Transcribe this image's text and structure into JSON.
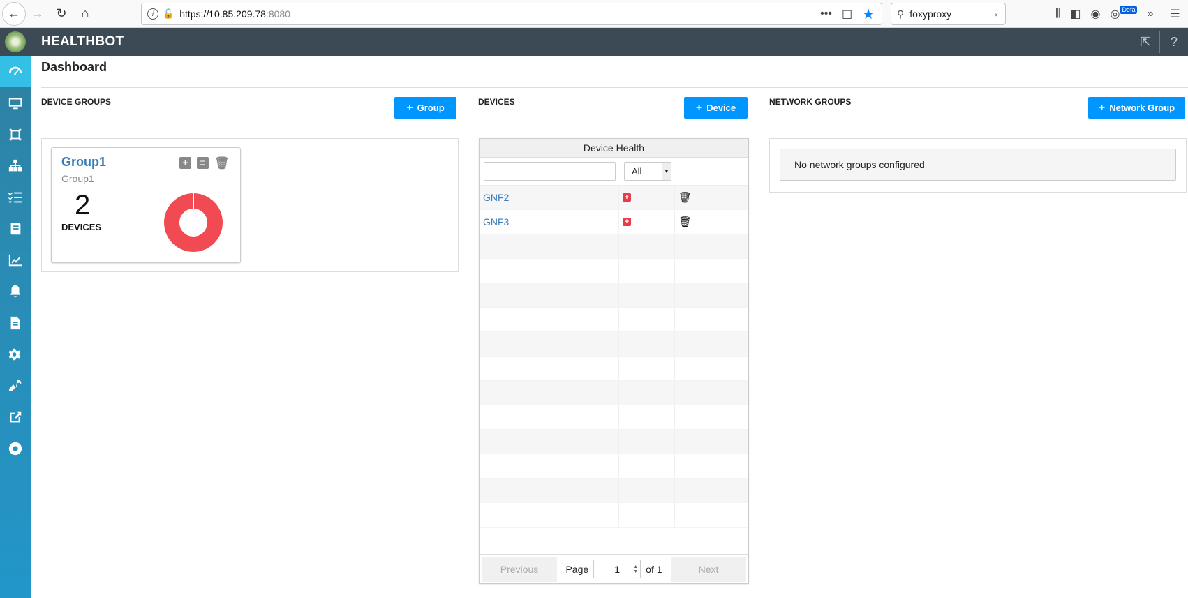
{
  "browser": {
    "url_host": "https://10.85.209.78",
    "url_port": ":8080",
    "search_text": "foxyproxy",
    "badge": "Defa"
  },
  "app": {
    "title": "HEALTHBOT",
    "help": "?"
  },
  "sidebar": {
    "items": [
      {
        "icon": "dashboard-icon",
        "active": true
      },
      {
        "icon": "monitor-icon"
      },
      {
        "icon": "crop-icon"
      },
      {
        "icon": "network-icon"
      },
      {
        "icon": "list-icon"
      },
      {
        "icon": "book-icon"
      },
      {
        "icon": "chart-icon"
      },
      {
        "icon": "bell-icon"
      },
      {
        "icon": "document-icon"
      },
      {
        "icon": "settings-icon"
      },
      {
        "icon": "wrench-icon"
      },
      {
        "icon": "external-link-icon"
      },
      {
        "icon": "lifebuoy-icon"
      }
    ]
  },
  "dashboard": {
    "title": "Dashboard",
    "device_groups": {
      "label": "DEVICE GROUPS",
      "add_label": "Group",
      "cards": [
        {
          "name": "Group1",
          "subtitle": "Group1",
          "count": "2",
          "count_label": "DEVICES",
          "health": {
            "red": 1.0
          }
        }
      ]
    },
    "devices": {
      "label": "DEVICES",
      "add_label": "Device",
      "table_header": "Device Health",
      "filter_value": "All",
      "rows": [
        {
          "name": "GNF2"
        },
        {
          "name": "GNF3"
        }
      ],
      "pager": {
        "previous": "Previous",
        "page_label": "Page",
        "page": "1",
        "of_label": "of 1",
        "next": "Next"
      }
    },
    "network_groups": {
      "label": "NETWORK GROUPS",
      "add_label": "Network Group",
      "empty_message": "No network groups configured"
    }
  },
  "colors": {
    "accent": "#0096ff",
    "header": "#3b4a54",
    "health_red": "#f24a52",
    "link": "#3a7bb8"
  }
}
